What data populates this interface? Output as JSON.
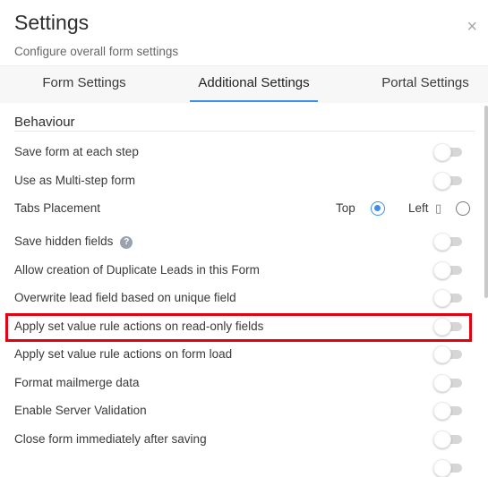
{
  "header": {
    "title": "Settings",
    "subtitle": "Configure overall form settings",
    "close_label": "×"
  },
  "tabs": [
    {
      "label": "Form Settings",
      "active": false
    },
    {
      "label": "Additional Settings",
      "active": true
    },
    {
      "label": "Portal Settings",
      "active": false
    }
  ],
  "section": {
    "title": "Behaviour"
  },
  "settings": [
    {
      "label": "Save form at each step",
      "enabled": false
    },
    {
      "label": "Use as Multi-step form",
      "enabled": false
    },
    {
      "label": "Tabs Placement"
    },
    {
      "label": "Save hidden fields",
      "enabled": false
    },
    {
      "label": "Allow creation of Duplicate Leads in this Form",
      "enabled": false
    },
    {
      "label": "Overwrite lead field based on unique field",
      "enabled": false
    },
    {
      "label": "Apply set value rule actions on read-only fields",
      "enabled": false,
      "highlighted": true
    },
    {
      "label": "Apply set value rule actions on form load",
      "enabled": false
    },
    {
      "label": "Format mailmerge data",
      "enabled": false
    },
    {
      "label": "Enable Server Validation",
      "enabled": false
    },
    {
      "label": "Close form immediately after saving",
      "enabled": false
    }
  ],
  "tabs_placement": {
    "options": [
      {
        "label": "Top",
        "selected": true
      },
      {
        "label": "Left",
        "selected": false
      }
    ]
  },
  "icons": {
    "help": "?",
    "mobile": "▯"
  },
  "colors": {
    "accent": "#3d8fe6",
    "highlight": "#e4000f",
    "toggle_off": "#d6d6d6"
  }
}
